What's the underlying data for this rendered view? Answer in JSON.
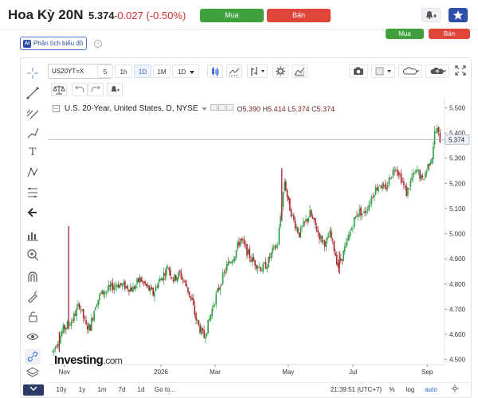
{
  "header": {
    "title": "Hoa Kỳ 20N",
    "price": "5.374",
    "change": "-0.027 (-0.50%)",
    "buy_label": "Mua",
    "sell_label": "Bán",
    "analysis_label": "Phân tích biểu đồ",
    "analysis_badge": "AI",
    "info_icon": "i",
    "colors": {
      "buy": "#3ea13c",
      "sell": "#e0453a",
      "negative": "#d32f2f",
      "star": "#2d4ea8"
    }
  },
  "toolbar": {
    "symbol": "US20YT=X",
    "timeframes": [
      "5",
      "1h",
      "1D",
      "1M",
      "1D"
    ],
    "selected_timeframe_index": 2,
    "icons": [
      "candles-icon",
      "line-style-icon",
      "indicators-icon",
      "settings-icon",
      "chart-type-icon",
      "camera-icon",
      "color-box-icon",
      "cloud-icon",
      "cloud-upload-icon",
      "fullscreen-icon"
    ]
  },
  "legend": {
    "title": "U.S. 20-Year, United States, D, NYSE",
    "open_label": "O",
    "open": "5.390",
    "high_label": "H",
    "high": "5.414",
    "low_label": "L",
    "low": "5.374",
    "close_label": "C",
    "close": "5.374"
  },
  "bottom": {
    "ranges": [
      "10y",
      "1y",
      "1m",
      "7d",
      "1d",
      "Go to..."
    ],
    "time": "21:39:51 (UTC+7)",
    "percent": "%",
    "log": "log",
    "auto": "auto"
  },
  "watermark": {
    "brand": "Investing",
    "suffix": ".com"
  },
  "chart_data": {
    "type": "candlestick",
    "title": "U.S. 20-Year, United States, D, NYSE",
    "x_tick_labels": [
      "Nov",
      "2026",
      "Mar",
      "May",
      "Jul",
      "Sep"
    ],
    "y_tick_labels": [
      "5.500",
      "5.400",
      "5.300",
      "5.200",
      "5.100",
      "5.000",
      "4.900",
      "4.800",
      "4.700",
      "4.600",
      "4.500"
    ],
    "ylim": [
      4.48,
      5.53
    ],
    "last_price": 5.374,
    "last_price_label": "5.374",
    "up_color": "#2e9e46",
    "down_color": "#a8262b",
    "grid": false,
    "close_path": [
      [
        0,
        4.53
      ],
      [
        8,
        4.62
      ],
      [
        15,
        4.66
      ],
      [
        20,
        4.72
      ],
      [
        25,
        4.63
      ],
      [
        28,
        4.63
      ],
      [
        32,
        4.72
      ],
      [
        36,
        4.76
      ],
      [
        42,
        4.78
      ],
      [
        48,
        4.8
      ],
      [
        55,
        4.79
      ],
      [
        60,
        4.78
      ],
      [
        65,
        4.82
      ],
      [
        70,
        4.79
      ],
      [
        75,
        4.76
      ],
      [
        78,
        4.8
      ],
      [
        82,
        4.83
      ],
      [
        86,
        4.87
      ],
      [
        90,
        4.82
      ],
      [
        95,
        4.84
      ],
      [
        100,
        4.79
      ],
      [
        104,
        4.73
      ],
      [
        107,
        4.66
      ],
      [
        110,
        4.62
      ],
      [
        113,
        4.59
      ],
      [
        116,
        4.64
      ],
      [
        120,
        4.72
      ],
      [
        125,
        4.8
      ],
      [
        130,
        4.87
      ],
      [
        136,
        4.92
      ],
      [
        140,
        4.98
      ],
      [
        144,
        4.94
      ],
      [
        148,
        4.9
      ],
      [
        152,
        4.88
      ],
      [
        156,
        4.86
      ],
      [
        160,
        4.88
      ],
      [
        164,
        4.93
      ],
      [
        168,
        4.96
      ],
      [
        170,
        5.07
      ],
      [
        173,
        5.21
      ],
      [
        176,
        5.12
      ],
      [
        180,
        5.05
      ],
      [
        184,
        5.0
      ],
      [
        188,
        5.04
      ],
      [
        192,
        5.08
      ],
      [
        196,
        5.03
      ],
      [
        200,
        4.98
      ],
      [
        204,
        4.96
      ],
      [
        207,
        5.0
      ],
      [
        210,
        4.94
      ],
      [
        213,
        4.87
      ],
      [
        216,
        4.91
      ],
      [
        220,
        4.97
      ],
      [
        224,
        5.04
      ],
      [
        228,
        5.09
      ],
      [
        232,
        5.08
      ],
      [
        236,
        5.12
      ],
      [
        240,
        5.17
      ],
      [
        244,
        5.2
      ],
      [
        248,
        5.17
      ],
      [
        252,
        5.23
      ],
      [
        256,
        5.27
      ],
      [
        260,
        5.22
      ],
      [
        264,
        5.16
      ],
      [
        268,
        5.22
      ],
      [
        272,
        5.25
      ],
      [
        276,
        5.21
      ],
      [
        280,
        5.27
      ],
      [
        283,
        5.31
      ],
      [
        285,
        5.4
      ],
      [
        287,
        5.41
      ],
      [
        289,
        5.374
      ]
    ],
    "spikes": [
      [
        5,
        4.53,
        4.61
      ],
      [
        12,
        4.62,
        5.03
      ],
      [
        171,
        5.05,
        5.26
      ],
      [
        214,
        4.84,
        4.93
      ]
    ]
  }
}
